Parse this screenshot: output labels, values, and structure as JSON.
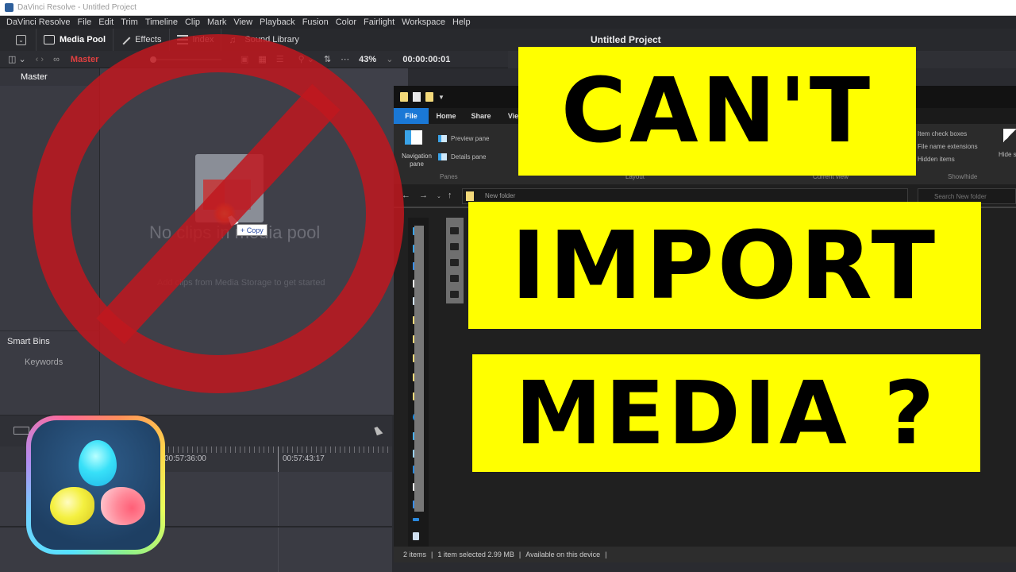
{
  "window": {
    "title": "DaVinci Resolve - Untitled Project"
  },
  "menubar": [
    "DaVinci Resolve",
    "File",
    "Edit",
    "Trim",
    "Timeline",
    "Clip",
    "Mark",
    "View",
    "Playback",
    "Fusion",
    "Color",
    "Fairlight",
    "Workspace",
    "Help"
  ],
  "toolbar": {
    "media_pool": "Media Pool",
    "effects": "Effects",
    "index": "Index",
    "sound_library": "Sound Library",
    "project_title": "Untitled Project"
  },
  "toolbar2": {
    "bin_label": "Master",
    "zoom_level": "43%",
    "timecode": "00:00:00:01"
  },
  "bins": {
    "master": "Master",
    "smart_bins": "Smart Bins",
    "keywords": "Keywords"
  },
  "media_pool": {
    "empty_title": "No clips in media pool",
    "empty_subtitle": "Add clips from Media Storage to get started",
    "drag_tooltip": "+ Copy"
  },
  "timeline": {
    "timecodes": [
      "00:57:36:00",
      "00:57:43:17"
    ]
  },
  "explorer": {
    "tabs": [
      "File",
      "Home",
      "Share",
      "View"
    ],
    "ribbon": {
      "navigation_pane": "Navigation pane",
      "preview_pane": "Preview pane",
      "details_pane": "Details pane",
      "panes_group": "Panes",
      "layout_group": "Layout",
      "current_view_group": "Current view",
      "item_check_boxes": "Item check boxes",
      "file_name_extensions": "File name extensions",
      "hidden_items": "Hidden items",
      "hide_selected": "Hide selected items",
      "show_hide_group": "Show/hide"
    },
    "address": "New folder",
    "search_placeholder": "Search New folder",
    "status": {
      "items": "2 items",
      "selected": "1 item selected  2.99 MB",
      "availability": "Available on this device"
    }
  },
  "overlay": {
    "line1": "CAN'T",
    "line2": "IMPORT",
    "line3": "MEDIA ?",
    "banner_color": "#ffff00",
    "prohibit_color": "#c0181e"
  }
}
